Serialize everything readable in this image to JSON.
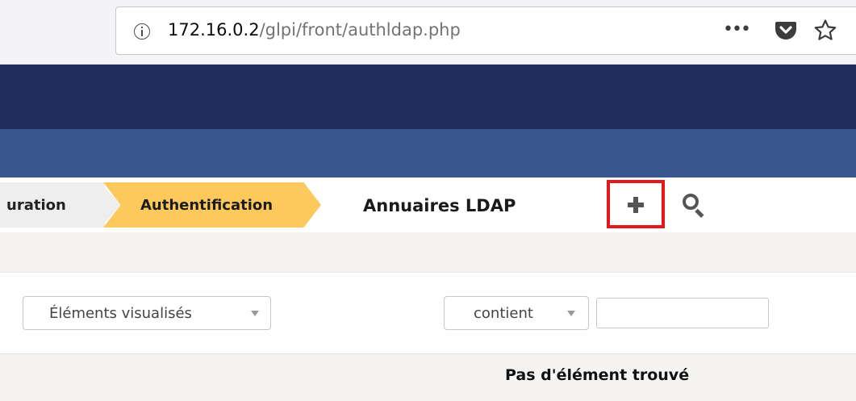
{
  "browser": {
    "url_host": "172.16.0.2",
    "url_path": "/glpi/front/authldap.php",
    "more_label": "•••"
  },
  "breadcrumb": {
    "items": [
      {
        "label": "uration"
      },
      {
        "label": "Authentification"
      }
    ],
    "current": "Annuaires LDAP"
  },
  "toolbar": {
    "add_icon": "plus-icon",
    "search_icon": "search-icon"
  },
  "search": {
    "field_select": "Éléments visualisés",
    "operator_select": "contient",
    "value": ""
  },
  "results": {
    "empty_message": "Pas d'élément trouvé"
  },
  "colors": {
    "header_dark": "#1f2c5e",
    "header_menu": "#39568f",
    "breadcrumb_active": "#fec95c",
    "highlight_border": "#e4171b"
  }
}
